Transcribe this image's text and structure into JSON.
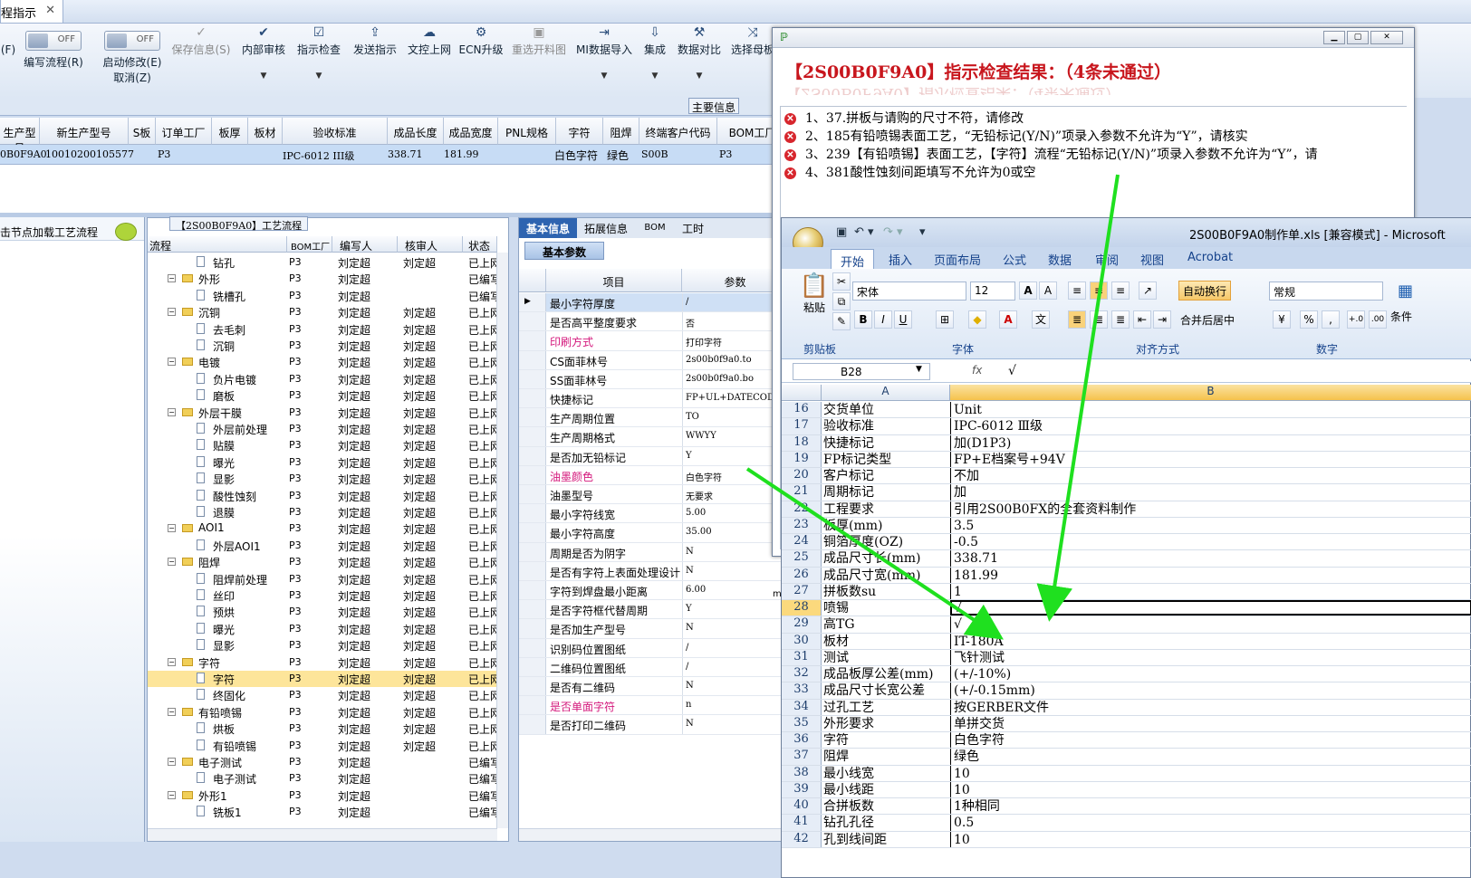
{
  "top_tab": {
    "label": "程指示",
    "close": "✕"
  },
  "ribbon": {
    "f_label": "(F)",
    "toggle_off": "OFF",
    "edit_flow": "编写流程(R)",
    "auto_modify": "启动修改(E)",
    "cancel": "取消(Z)",
    "buttons": [
      "保存信息(S)",
      "内部审核",
      "指示检查",
      "发送指示",
      "文控上网",
      "ECN升级",
      "重选开料图",
      "MI数据导入",
      "集成",
      "数据对比",
      "选择母板"
    ]
  },
  "main_info_label": "主要信息",
  "order_grid": {
    "headers": [
      "生产型号",
      "新生产型号",
      "S板",
      "订单工厂",
      "板厚",
      "板材",
      "验收标准",
      "成品长度",
      "成品宽度",
      "PNL规格",
      "字符",
      "阻焊",
      "终端客户代码",
      "BOM工厂"
    ],
    "row": [
      "0B0F9A0",
      "10010200105577",
      "",
      "P3",
      "",
      "",
      "IPC-6012 III级",
      "338.71",
      "181.99",
      "",
      "白色字符",
      "绿色",
      "S00B",
      "P3"
    ]
  },
  "left_panel": {
    "hint": "击节点加载工艺流程"
  },
  "flow_tree": {
    "caption": "【2S00B0F9A0】工艺流程",
    "headers": [
      "流程",
      "BOM工厂",
      "编写人",
      "核审人",
      "状态"
    ],
    "rows": [
      {
        "name": "钻孔",
        "level": 2,
        "factory": "P3",
        "writer": "刘定超",
        "reviewer": "刘定超",
        "status": "已上网"
      },
      {
        "name": "外形",
        "level": 1,
        "factory": "P3",
        "writer": "刘定超",
        "reviewer": "",
        "status": "已编写"
      },
      {
        "name": "铣槽孔",
        "level": 2,
        "factory": "P3",
        "writer": "刘定超",
        "reviewer": "",
        "status": "已编写"
      },
      {
        "name": "沉铜",
        "level": 1,
        "factory": "P3",
        "writer": "刘定超",
        "reviewer": "刘定超",
        "status": "已上网"
      },
      {
        "name": "去毛刺",
        "level": 2,
        "factory": "P3",
        "writer": "刘定超",
        "reviewer": "刘定超",
        "status": "已上网"
      },
      {
        "name": "沉铜",
        "level": 2,
        "factory": "P3",
        "writer": "刘定超",
        "reviewer": "刘定超",
        "status": "已上网"
      },
      {
        "name": "电镀",
        "level": 1,
        "factory": "P3",
        "writer": "刘定超",
        "reviewer": "刘定超",
        "status": "已上网"
      },
      {
        "name": "负片电镀",
        "level": 2,
        "factory": "P3",
        "writer": "刘定超",
        "reviewer": "刘定超",
        "status": "已上网"
      },
      {
        "name": "磨板",
        "level": 2,
        "factory": "P3",
        "writer": "刘定超",
        "reviewer": "刘定超",
        "status": "已上网"
      },
      {
        "name": "外层干膜",
        "level": 1,
        "factory": "P3",
        "writer": "刘定超",
        "reviewer": "刘定超",
        "status": "已上网"
      },
      {
        "name": "外层前处理",
        "level": 2,
        "factory": "P3",
        "writer": "刘定超",
        "reviewer": "刘定超",
        "status": "已上网"
      },
      {
        "name": "贴膜",
        "level": 2,
        "factory": "P3",
        "writer": "刘定超",
        "reviewer": "刘定超",
        "status": "已上网"
      },
      {
        "name": "曝光",
        "level": 2,
        "factory": "P3",
        "writer": "刘定超",
        "reviewer": "刘定超",
        "status": "已上网"
      },
      {
        "name": "显影",
        "level": 2,
        "factory": "P3",
        "writer": "刘定超",
        "reviewer": "刘定超",
        "status": "已上网"
      },
      {
        "name": "酸性蚀刻",
        "level": 2,
        "factory": "P3",
        "writer": "刘定超",
        "reviewer": "刘定超",
        "status": "已上网"
      },
      {
        "name": "退膜",
        "level": 2,
        "factory": "P3",
        "writer": "刘定超",
        "reviewer": "刘定超",
        "status": "已上网"
      },
      {
        "name": "AOI1",
        "level": 1,
        "factory": "P3",
        "writer": "刘定超",
        "reviewer": "刘定超",
        "status": "已上网"
      },
      {
        "name": "外层AOI1",
        "level": 2,
        "factory": "P3",
        "writer": "刘定超",
        "reviewer": "刘定超",
        "status": "已上网"
      },
      {
        "name": "阻焊",
        "level": 1,
        "factory": "P3",
        "writer": "刘定超",
        "reviewer": "刘定超",
        "status": "已上网"
      },
      {
        "name": "阻焊前处理",
        "level": 2,
        "factory": "P3",
        "writer": "刘定超",
        "reviewer": "刘定超",
        "status": "已上网"
      },
      {
        "name": "丝印",
        "level": 2,
        "factory": "P3",
        "writer": "刘定超",
        "reviewer": "刘定超",
        "status": "已上网"
      },
      {
        "name": "预烘",
        "level": 2,
        "factory": "P3",
        "writer": "刘定超",
        "reviewer": "刘定超",
        "status": "已上网"
      },
      {
        "name": "曝光",
        "level": 2,
        "factory": "P3",
        "writer": "刘定超",
        "reviewer": "刘定超",
        "status": "已上网"
      },
      {
        "name": "显影",
        "level": 2,
        "factory": "P3",
        "writer": "刘定超",
        "reviewer": "刘定超",
        "status": "已上网"
      },
      {
        "name": "字符",
        "level": 1,
        "factory": "P3",
        "writer": "刘定超",
        "reviewer": "刘定超",
        "status": "已上网"
      },
      {
        "name": "字符",
        "level": 2,
        "factory": "P3",
        "writer": "刘定超",
        "reviewer": "刘定超",
        "status": "已上网",
        "selected": true
      },
      {
        "name": "终固化",
        "level": 2,
        "factory": "P3",
        "writer": "刘定超",
        "reviewer": "刘定超",
        "status": "已上网"
      },
      {
        "name": "有铅喷锡",
        "level": 1,
        "factory": "P3",
        "writer": "刘定超",
        "reviewer": "刘定超",
        "status": "已上网"
      },
      {
        "name": "烘板",
        "level": 2,
        "factory": "P3",
        "writer": "刘定超",
        "reviewer": "刘定超",
        "status": "已上网"
      },
      {
        "name": "有铅喷锡",
        "level": 2,
        "factory": "P3",
        "writer": "刘定超",
        "reviewer": "刘定超",
        "status": "已上网"
      },
      {
        "name": "电子测试",
        "level": 1,
        "factory": "P3",
        "writer": "刘定超",
        "reviewer": "",
        "status": "已编写"
      },
      {
        "name": "电子测试",
        "level": 2,
        "factory": "P3",
        "writer": "刘定超",
        "reviewer": "",
        "status": "已编写"
      },
      {
        "name": "外形1",
        "level": 1,
        "factory": "P3",
        "writer": "刘定超",
        "reviewer": "",
        "status": "已编写"
      },
      {
        "name": "铣板1",
        "level": 2,
        "factory": "P3",
        "writer": "刘定超",
        "reviewer": "",
        "status": "已编写"
      }
    ]
  },
  "props": {
    "tabs": [
      "基本信息",
      "拓展信息",
      "BOM",
      "工时"
    ],
    "subtab": "基本参数",
    "headers": [
      "项目",
      "参数"
    ],
    "overflow_text": "mi",
    "rows": [
      {
        "k": "最小字符厚度",
        "v": "/",
        "cur": true
      },
      {
        "k": "是否高平整度要求",
        "v": "否"
      },
      {
        "k": "印刷方式",
        "v": "打印字符",
        "pink": true
      },
      {
        "k": "CS面菲林号",
        "v": "2s00b0f9a0.to"
      },
      {
        "k": "SS面菲林号",
        "v": "2s00b0f9a0.bo"
      },
      {
        "k": "快捷标记",
        "v": "FP+UL+DATECODE"
      },
      {
        "k": "生产周期位置",
        "v": "TO"
      },
      {
        "k": "生产周期格式",
        "v": "WWYY"
      },
      {
        "k": "是否加无铅标记",
        "v": "Y"
      },
      {
        "k": "油墨颜色",
        "v": "白色字符",
        "pink": true
      },
      {
        "k": "油墨型号",
        "v": "无要求"
      },
      {
        "k": "最小字符线宽",
        "v": "5.00"
      },
      {
        "k": "最小字符高度",
        "v": "35.00"
      },
      {
        "k": "周期是否为阴字",
        "v": "N"
      },
      {
        "k": "是否有字符上表面处理设计",
        "v": "N"
      },
      {
        "k": "字符到焊盘最小距离",
        "v": "6.00"
      },
      {
        "k": "是否字符框代替周期",
        "v": "Y"
      },
      {
        "k": "是否加生产型号",
        "v": "N"
      },
      {
        "k": "识别码位置图纸",
        "v": "/"
      },
      {
        "k": "二维码位置图纸",
        "v": "/"
      },
      {
        "k": "是否有二维码",
        "v": "N"
      },
      {
        "k": "是否单面字符",
        "v": "n",
        "pink": true
      },
      {
        "k": "是否打印二维码",
        "v": "N"
      }
    ]
  },
  "check_dialog": {
    "title": "【2S00B0F9A0】指示检查结果：（4条未通过）",
    "errors": [
      "1、37.拼板与请购的尺寸不符，请修改",
      "2、185有铅喷锡表面工艺，“无铅标记(Y/N)”项录入参数不允许为“Y”，请核实",
      "3、239【有铅喷锡】表面工艺，【字符】流程“无铅标记(Y/N)”项录入参数不允许为“Y”，请",
      "4、381酸性蚀刻间距填写不允许为0或空"
    ]
  },
  "excel": {
    "title": "2S00B0F9A0制作单.xls  [兼容模式] - Microsoft",
    "tabs": [
      "开始",
      "插入",
      "页面布局",
      "公式",
      "数据",
      "审阅",
      "视图",
      "Acrobat"
    ],
    "font_name": "宋体",
    "font_size": "12",
    "wrap_text": "自动换行",
    "merge_center": "合并后居中",
    "number_format": "常规",
    "paste": "粘贴",
    "conditional": "条件",
    "groups": [
      "剪贴板",
      "字体",
      "对齐方式",
      "数字"
    ],
    "name_box": "B28",
    "fx": "fx",
    "formula": "√",
    "col_headers": [
      "A",
      "B"
    ],
    "rows": [
      {
        "n": "16",
        "a": "交货单位",
        "b": "Unit"
      },
      {
        "n": "17",
        "a": "验收标准",
        "b": "IPC-6012 Ⅲ级"
      },
      {
        "n": "18",
        "a": "快捷标记",
        "b": "加(D1P3)"
      },
      {
        "n": "19",
        "a": "FP标记类型",
        "b": "FP+E档案号+94V"
      },
      {
        "n": "20",
        "a": "客户标记",
        "b": "不加"
      },
      {
        "n": "21",
        "a": "周期标记",
        "b": "加"
      },
      {
        "n": "22",
        "a": "工程要求",
        "b": "引用2S00B0FX的全套资料制作"
      },
      {
        "n": "23",
        "a": "板厚(mm)",
        "b": "3.5"
      },
      {
        "n": "24",
        "a": "铜箔厚度(OZ)",
        "b": "-0.5"
      },
      {
        "n": "25",
        "a": "成品尺寸长(mm)",
        "b": "338.71"
      },
      {
        "n": "26",
        "a": "成品尺寸宽(mm)",
        "b": "181.99"
      },
      {
        "n": "27",
        "a": "拼板数su",
        "b": "1"
      },
      {
        "n": "28",
        "a": "喷锡",
        "b": "√",
        "active": true
      },
      {
        "n": "29",
        "a": "高TG",
        "b": "√"
      },
      {
        "n": "30",
        "a": "板材",
        "b": "IT-180A"
      },
      {
        "n": "31",
        "a": "测试",
        "b": "飞针测试"
      },
      {
        "n": "32",
        "a": "成品板厚公差(mm)",
        "b": "(+/-10%)"
      },
      {
        "n": "33",
        "a": "成品尺寸长宽公差",
        "b": "(+/-0.15mm)"
      },
      {
        "n": "34",
        "a": "过孔工艺",
        "b": "按GERBER文件"
      },
      {
        "n": "35",
        "a": "外形要求",
        "b": "单拼交货"
      },
      {
        "n": "36",
        "a": "字符",
        "b": "白色字符"
      },
      {
        "n": "37",
        "a": "阻焊",
        "b": "绿色"
      },
      {
        "n": "38",
        "a": "最小线宽",
        "b": "10"
      },
      {
        "n": "39",
        "a": "最小线距",
        "b": "10"
      },
      {
        "n": "40",
        "a": "合拼板数",
        "b": "1种相同"
      },
      {
        "n": "41",
        "a": "钻孔孔径",
        "b": "0.5"
      },
      {
        "n": "42",
        "a": "孔到线间距",
        "b": "10"
      }
    ]
  },
  "colors": {
    "arrow": "#1fe01f",
    "error": "#c8161d",
    "pink_label": "#d4187c",
    "selected_row": "#fde59a"
  }
}
